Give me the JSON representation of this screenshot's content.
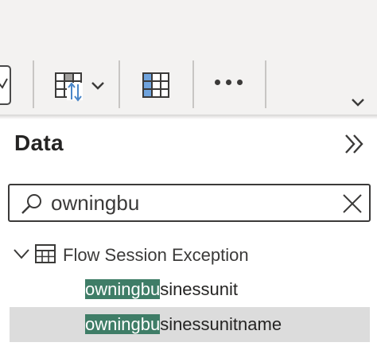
{
  "toolbar": {
    "checkbox_icon": "checkbox-partial",
    "transform_icon": "table-sort-icon",
    "table_view_icon": "table-grid-icon",
    "more_icon": "more-ellipsis-icon",
    "collapse_icon": "chevron-down-icon"
  },
  "pane": {
    "title": "Data",
    "collapse_icon": "double-chevron-right-icon"
  },
  "search": {
    "value": "owningbu",
    "placeholder": "Search"
  },
  "tree": {
    "table_name": "Flow Session Exception",
    "fields": [
      {
        "match": "owningbu",
        "rest": "sinessunit",
        "selected": false
      },
      {
        "match": "owningbu",
        "rest": "sinessunitname",
        "selected": true
      }
    ]
  },
  "colors": {
    "highlight": "#3f7d67",
    "selected_row": "#dcdcdc",
    "accent_blue": "#4a86c8"
  }
}
